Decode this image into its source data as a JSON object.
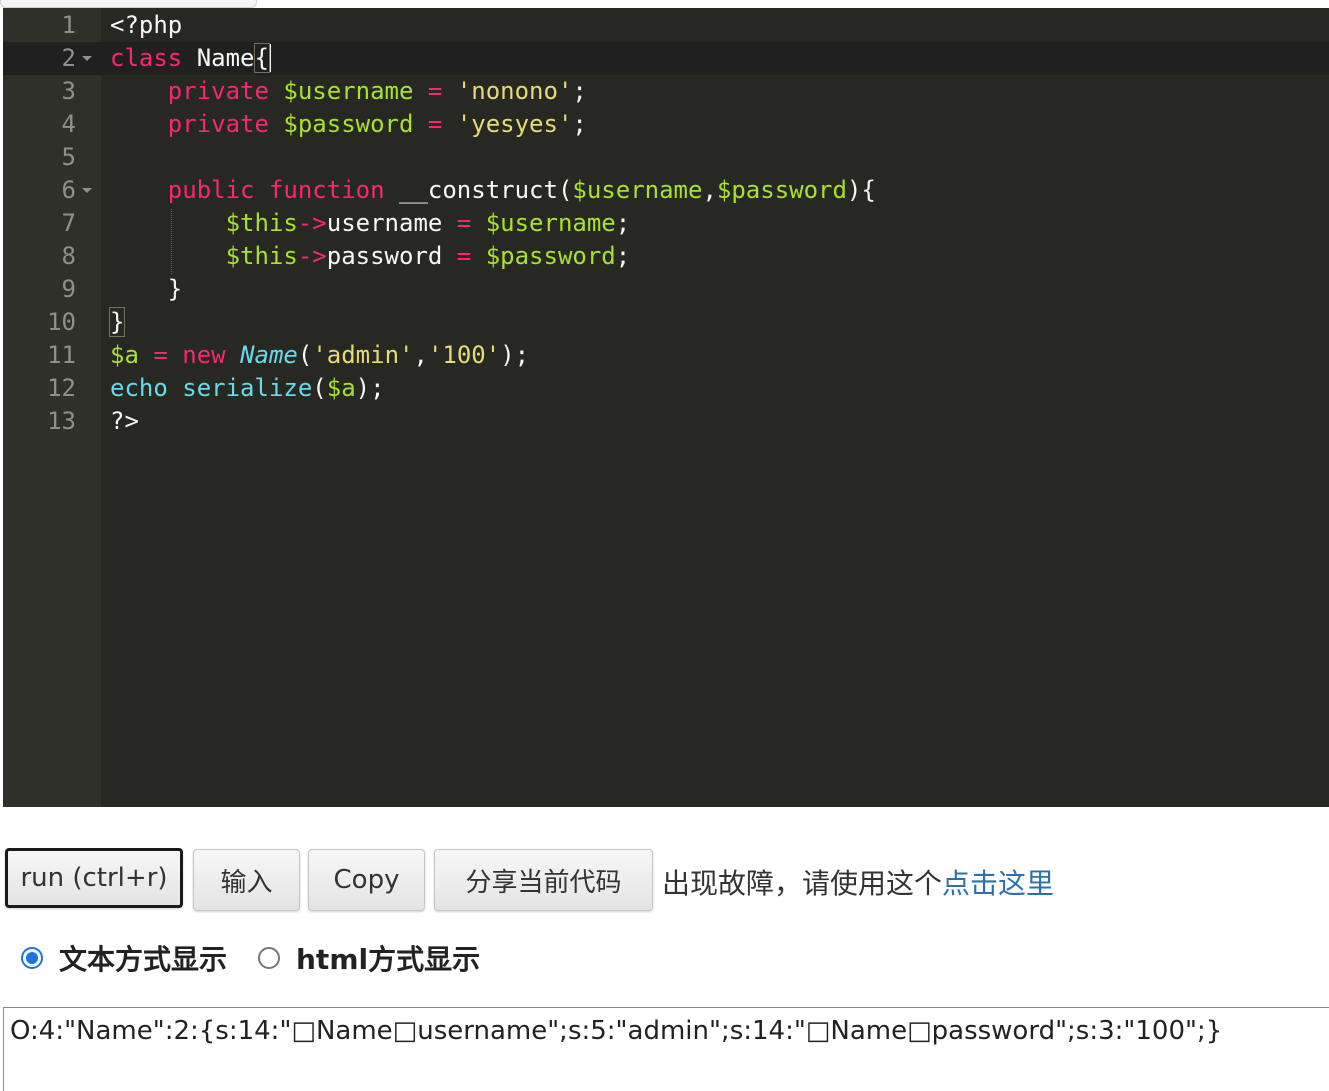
{
  "editor": {
    "lines": [
      {
        "num": "1",
        "tokens": [
          {
            "t": "<?php",
            "c": "plain"
          }
        ]
      },
      {
        "num": "2",
        "fold": true,
        "active": true,
        "tokens": [
          {
            "t": "class",
            "c": "kw"
          },
          {
            "t": " Name",
            "c": "plain"
          },
          {
            "t": "{",
            "c": "bracket"
          }
        ]
      },
      {
        "num": "3",
        "tokens": [
          {
            "t": "    ",
            "c": "plain"
          },
          {
            "t": "private",
            "c": "kw"
          },
          {
            "t": " ",
            "c": "plain"
          },
          {
            "t": "$username",
            "c": "vr"
          },
          {
            "t": " ",
            "c": "plain"
          },
          {
            "t": "=",
            "c": "kw"
          },
          {
            "t": " ",
            "c": "plain"
          },
          {
            "t": "'nonono'",
            "c": "st"
          },
          {
            "t": ";",
            "c": "plain"
          }
        ]
      },
      {
        "num": "4",
        "tokens": [
          {
            "t": "    ",
            "c": "plain"
          },
          {
            "t": "private",
            "c": "kw"
          },
          {
            "t": " ",
            "c": "plain"
          },
          {
            "t": "$password",
            "c": "vr"
          },
          {
            "t": " ",
            "c": "plain"
          },
          {
            "t": "=",
            "c": "kw"
          },
          {
            "t": " ",
            "c": "plain"
          },
          {
            "t": "'yesyes'",
            "c": "st"
          },
          {
            "t": ";",
            "c": "plain"
          }
        ]
      },
      {
        "num": "5",
        "tokens": []
      },
      {
        "num": "6",
        "fold": true,
        "tokens": [
          {
            "t": "    ",
            "c": "plain"
          },
          {
            "t": "public",
            "c": "kw"
          },
          {
            "t": " ",
            "c": "plain"
          },
          {
            "t": "function",
            "c": "kw"
          },
          {
            "t": " __construct(",
            "c": "plain"
          },
          {
            "t": "$username",
            "c": "vr"
          },
          {
            "t": ",",
            "c": "plain"
          },
          {
            "t": "$password",
            "c": "vr"
          },
          {
            "t": "){",
            "c": "plain"
          }
        ]
      },
      {
        "num": "7",
        "tokens": [
          {
            "t": "        ",
            "c": "plain"
          },
          {
            "t": "$this",
            "c": "vr"
          },
          {
            "t": "->",
            "c": "kw"
          },
          {
            "t": "username ",
            "c": "plain"
          },
          {
            "t": "=",
            "c": "kw"
          },
          {
            "t": " ",
            "c": "plain"
          },
          {
            "t": "$username",
            "c": "vr"
          },
          {
            "t": ";",
            "c": "plain"
          }
        ]
      },
      {
        "num": "8",
        "tokens": [
          {
            "t": "        ",
            "c": "plain"
          },
          {
            "t": "$this",
            "c": "vr"
          },
          {
            "t": "->",
            "c": "kw"
          },
          {
            "t": "password ",
            "c": "plain"
          },
          {
            "t": "=",
            "c": "kw"
          },
          {
            "t": " ",
            "c": "plain"
          },
          {
            "t": "$password",
            "c": "vr"
          },
          {
            "t": ";",
            "c": "plain"
          }
        ]
      },
      {
        "num": "9",
        "tokens": [
          {
            "t": "    }",
            "c": "plain"
          }
        ]
      },
      {
        "num": "10",
        "tokens": [
          {
            "t": "}",
            "c": "bracket"
          }
        ]
      },
      {
        "num": "11",
        "tokens": [
          {
            "t": "$a",
            "c": "vr"
          },
          {
            "t": " ",
            "c": "plain"
          },
          {
            "t": "=",
            "c": "kw"
          },
          {
            "t": " ",
            "c": "plain"
          },
          {
            "t": "new",
            "c": "kw"
          },
          {
            "t": " ",
            "c": "plain"
          },
          {
            "t": "Name",
            "c": "cls"
          },
          {
            "t": "(",
            "c": "plain"
          },
          {
            "t": "'admin'",
            "c": "st"
          },
          {
            "t": ",",
            "c": "plain"
          },
          {
            "t": "'100'",
            "c": "st"
          },
          {
            "t": ");",
            "c": "plain"
          }
        ]
      },
      {
        "num": "12",
        "tokens": [
          {
            "t": "echo",
            "c": "fn"
          },
          {
            "t": " ",
            "c": "plain"
          },
          {
            "t": "serialize",
            "c": "fn"
          },
          {
            "t": "(",
            "c": "plain"
          },
          {
            "t": "$a",
            "c": "vr"
          },
          {
            "t": ");",
            "c": "plain"
          }
        ]
      },
      {
        "num": "13",
        "tokens": [
          {
            "t": "?>",
            "c": "plain"
          }
        ]
      }
    ]
  },
  "toolbar": {
    "run_label": "run (ctrl+r)",
    "input_label": "输入",
    "copy_label": "Copy",
    "share_label": "分享当前代码",
    "notice_text": "出现故障，请使用这个",
    "notice_link": "点击这里"
  },
  "display_mode": {
    "options": [
      {
        "label": "文本方式显示",
        "checked": true
      },
      {
        "label": "html方式显示",
        "checked": false
      }
    ]
  },
  "output": {
    "text": "O:4:\"Name\":2:{s:14:\"□Name□username\";s:5:\"admin\";s:14:\"□Name□password\";s:3:\"100\";}"
  }
}
